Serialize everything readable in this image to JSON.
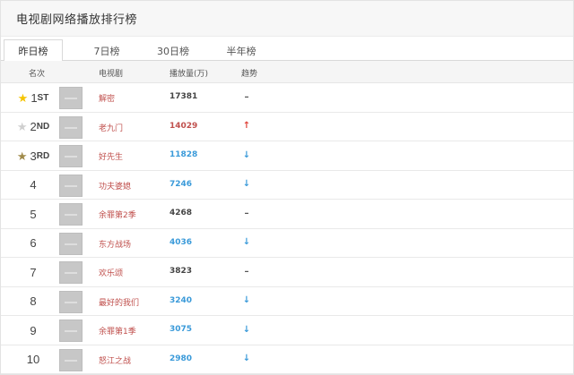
{
  "title": "电视剧网络播放排行榜",
  "tabs": [
    {
      "label": "昨日榜",
      "active": true
    },
    {
      "label": "7日榜",
      "active": false
    },
    {
      "label": "30日榜",
      "active": false
    },
    {
      "label": "半年榜",
      "active": false
    }
  ],
  "columns": {
    "rank": "名次",
    "show": "电视剧",
    "plays": "播放量(万)",
    "trend": "趋势"
  },
  "rows": [
    {
      "rank": "1",
      "suffix": "ST",
      "star": "gold",
      "show": "解密",
      "plays": "17381",
      "trend": "flat",
      "plays_color": "#444444"
    },
    {
      "rank": "2",
      "suffix": "ND",
      "star": "silver",
      "show": "老九门",
      "plays": "14029",
      "trend": "up",
      "plays_color": "#c0504d"
    },
    {
      "rank": "3",
      "suffix": "RD",
      "star": "bronze",
      "show": "好先生",
      "plays": "11828",
      "trend": "down",
      "plays_color": "#3a9ad9"
    },
    {
      "rank": "4",
      "suffix": "",
      "star": "",
      "show": "功夫婆媳",
      "plays": "7246",
      "trend": "down",
      "plays_color": "#3a9ad9"
    },
    {
      "rank": "5",
      "suffix": "",
      "star": "",
      "show": "余罪第2季",
      "plays": "4268",
      "trend": "flat",
      "plays_color": "#444444"
    },
    {
      "rank": "6",
      "suffix": "",
      "star": "",
      "show": "东方战场",
      "plays": "4036",
      "trend": "down",
      "plays_color": "#3a9ad9"
    },
    {
      "rank": "7",
      "suffix": "",
      "star": "",
      "show": "欢乐颂",
      "plays": "3823",
      "trend": "flat",
      "plays_color": "#444444"
    },
    {
      "rank": "8",
      "suffix": "",
      "star": "",
      "show": "最好的我们",
      "plays": "3240",
      "trend": "down",
      "plays_color": "#3a9ad9"
    },
    {
      "rank": "9",
      "suffix": "",
      "star": "",
      "show": "余罪第1季",
      "plays": "3075",
      "trend": "down",
      "plays_color": "#3a9ad9"
    },
    {
      "rank": "10",
      "suffix": "",
      "star": "",
      "show": "怒江之战",
      "plays": "2980",
      "trend": "down",
      "plays_color": "#3a9ad9"
    }
  ],
  "colors": {
    "star_gold": "#f5c400",
    "star_silver": "#cfcfcf",
    "star_bronze": "#a08a4a",
    "trend_up": "#e0433a",
    "trend_down": "#3a9ad9",
    "trend_flat": "#555555",
    "show_link": "#c0504d"
  }
}
